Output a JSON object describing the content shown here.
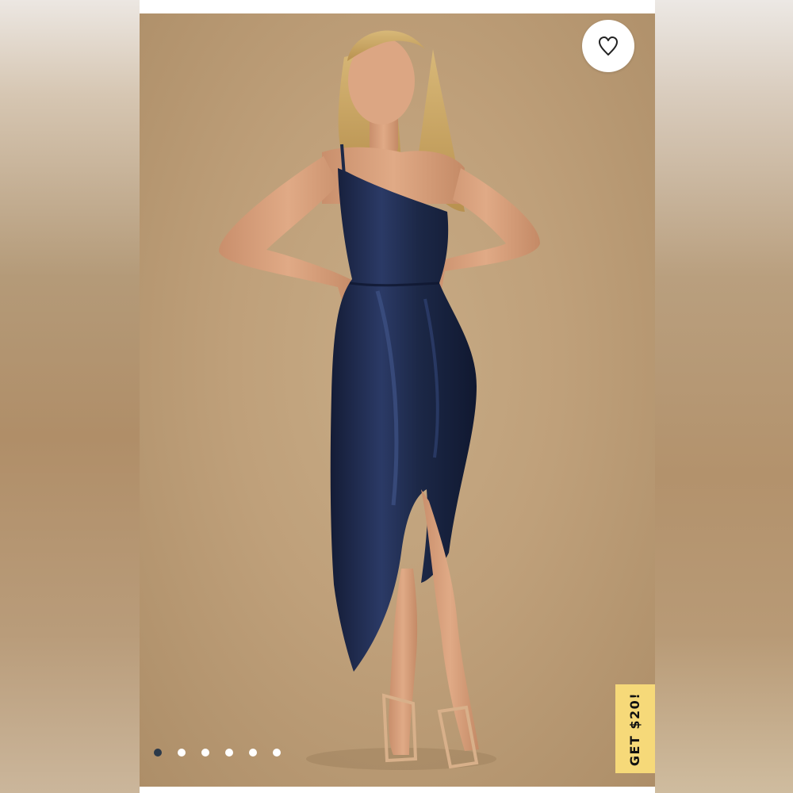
{
  "product_viewer": {
    "favorite_icon": "heart-outline-icon",
    "carousel": {
      "total_slides": 6,
      "active_index": 0
    },
    "promo_tab": {
      "label": "GET $20!",
      "color": "#f6d979"
    },
    "colors": {
      "backdrop": "#bfa07a",
      "dress": "#1c2847",
      "dot_active": "#2c3a4a",
      "dot_inactive": "#ffffff"
    }
  }
}
